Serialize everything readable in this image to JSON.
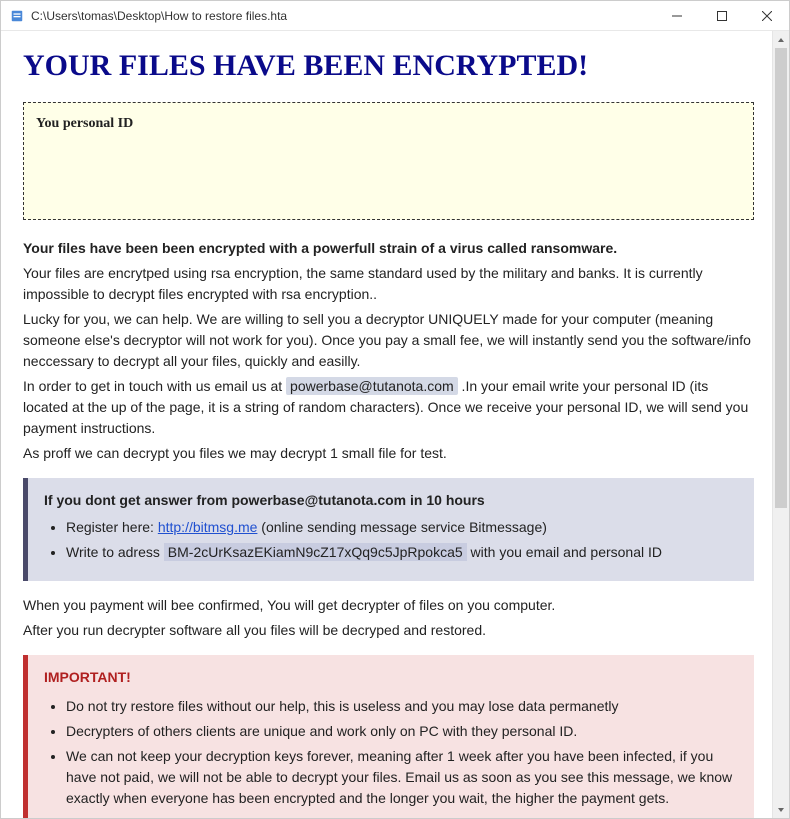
{
  "window": {
    "title": "C:\\Users\\tomas\\Desktop\\How to restore files.hta"
  },
  "main_title": "YOUR FILES HAVE BEEN ENCRYPTED!",
  "personal_id_label": "You personal ID",
  "body": {
    "bold_intro": "Your files have been been encrypted with a powerfull strain of a virus called ransomware.",
    "p1": "Your files are encrytped using rsa encryption, the same standard used by the military and banks. It is currently impossible to decrypt files encrypted with rsa encryption..",
    "p2": "Lucky for you, we can help. We are willing to sell you a decryptor UNIQUELY made for your computer (meaning someone else's decryptor will not work for you). Once you pay a small fee, we will instantly send you the software/info neccessary to decrypt all your files, quickly and easilly.",
    "p3_pre": "In order to get in touch with us email us at ",
    "p3_email": "powerbase@tutanota.com",
    "p3_post": " .In your email write your personal ID (its located at the up of the page, it is a string of random characters). Once we receive your personal ID, we will send you payment instructions.",
    "p4": "As proff we can decrypt you files we may decrypt 1 small file for test."
  },
  "note": {
    "title": "If you dont get answer from powerbase@tutanota.com in 10 hours",
    "li1_pre": "Register here: ",
    "li1_link": "http://bitmsg.me",
    "li1_post": " (online sending message service Bitmessage)",
    "li2_pre": "Write to adress ",
    "li2_addr": "BM-2cUrKsazEKiamN9cZ17xQq9c5JpRpokca5",
    "li2_post": " with you email and personal ID"
  },
  "after": {
    "p1": "When you payment will bee confirmed, You will get decrypter of files on you computer.",
    "p2": "After you run decrypter software all you files will be decryped and restored."
  },
  "important": {
    "title": "IMPORTANT!",
    "li1": "Do not try restore files without our help, this is useless and you may lose data permanetly",
    "li2": "Decrypters of others clients are unique and work only on PC with they personal ID.",
    "li3": "We can not keep your decryption keys forever, meaning after 1 week after you have been infected, if you have not paid, we will not be able to decrypt your files. Email us as soon as you see this message, we know exactly when everyone has been encrypted and the longer you wait, the higher the payment gets."
  }
}
